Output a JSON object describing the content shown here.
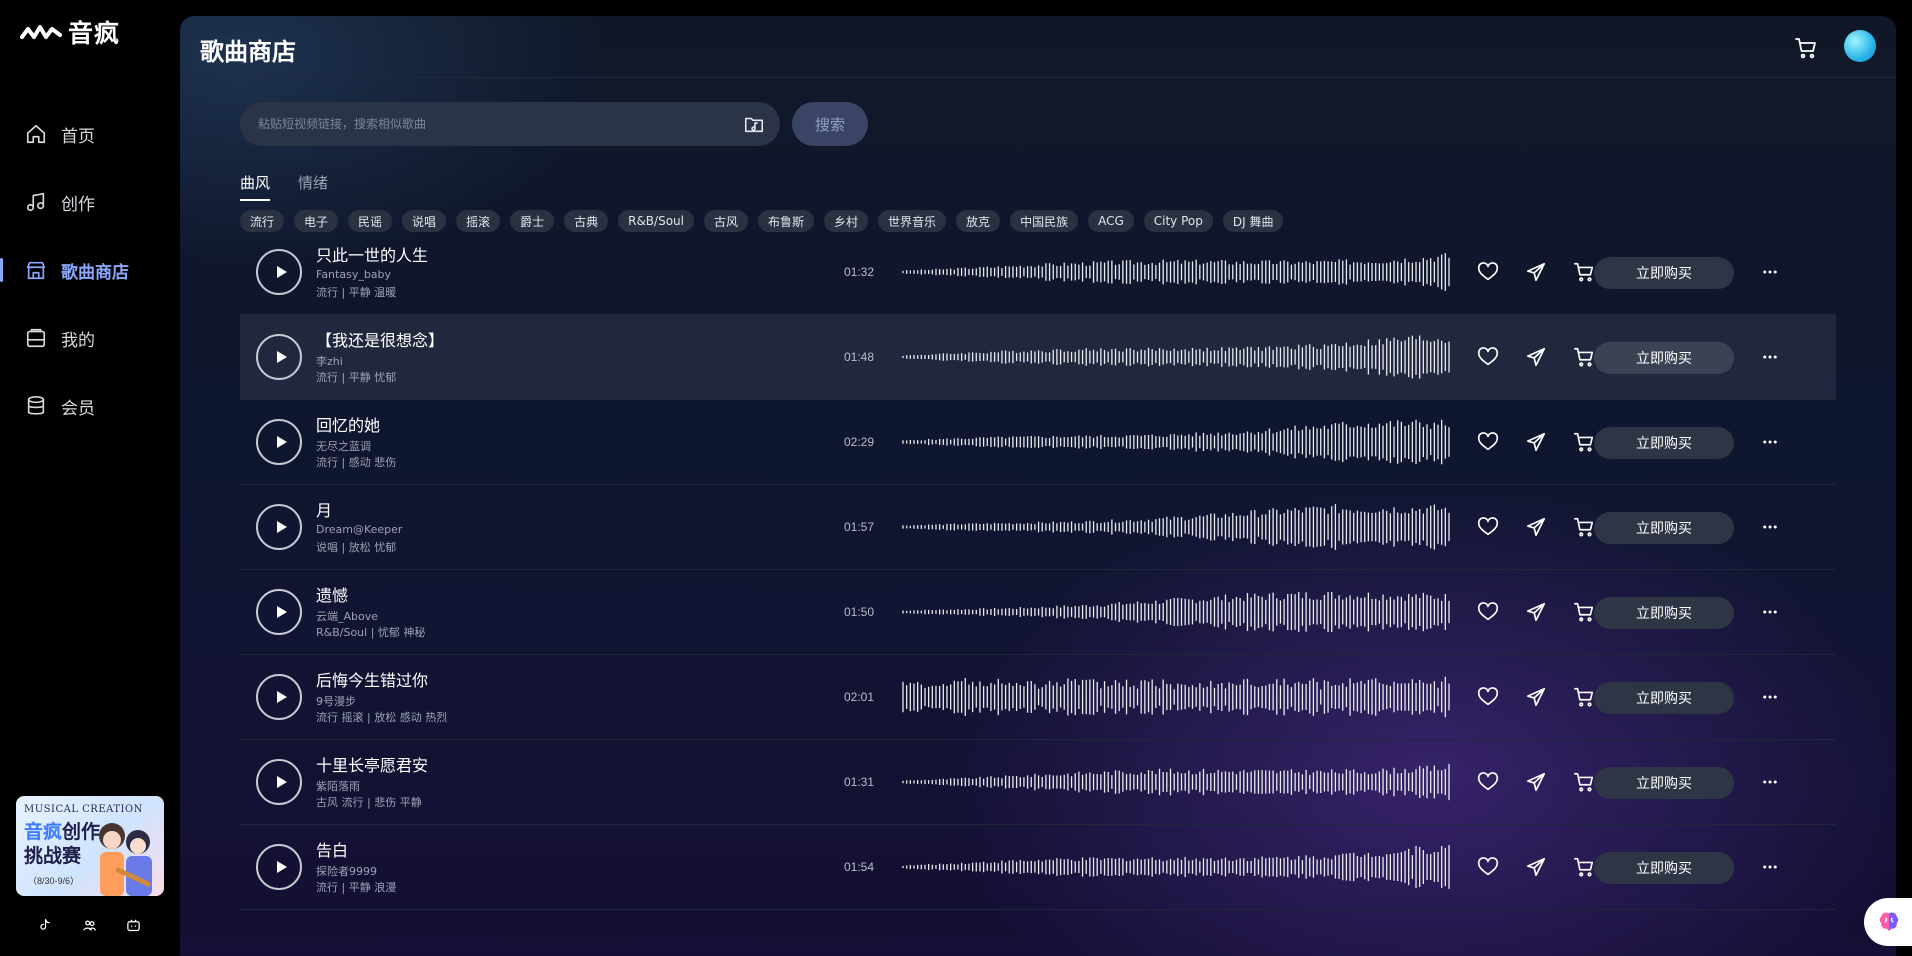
{
  "app": {
    "name": "音疯"
  },
  "sidebar": {
    "items": [
      {
        "label": "首页",
        "icon": "home-icon"
      },
      {
        "label": "创作",
        "icon": "music-note-icon"
      },
      {
        "label": "歌曲商店",
        "icon": "store-icon",
        "active": true
      },
      {
        "label": "我的",
        "icon": "folder-icon"
      },
      {
        "label": "会员",
        "icon": "database-icon"
      }
    ],
    "banner": {
      "top": "MUSICAL CREATION",
      "title_hl": "音疯",
      "title_rest": "创作",
      "title_line2": "挑战赛",
      "date": "（8/30-9/6）"
    }
  },
  "header": {
    "title": "歌曲商店"
  },
  "search": {
    "placeholder": "粘贴短视频链接，搜索相似歌曲",
    "button": "搜索"
  },
  "tabs": [
    {
      "label": "曲风",
      "active": true
    },
    {
      "label": "情绪",
      "active": false
    }
  ],
  "chips": [
    "流行",
    "电子",
    "民谣",
    "说唱",
    "摇滚",
    "爵士",
    "古典",
    "R&B/Soul",
    "古风",
    "布鲁斯",
    "乡村",
    "世界音乐",
    "放克",
    "中国民族",
    "ACG",
    "City Pop",
    "DJ 舞曲"
  ],
  "songs": [
    {
      "title": "只此一世的人生",
      "artist": "Fantasy_baby",
      "tags": "流行 | 平静 温暖",
      "duration": "01:32"
    },
    {
      "title": "【我还是很想念】",
      "artist": "李zhi",
      "tags": "流行 | 平静 忧郁",
      "duration": "01:48"
    },
    {
      "title": "回忆的她",
      "artist": "无尽之蓝调",
      "tags": "流行 | 感动 悲伤",
      "duration": "02:29"
    },
    {
      "title": "月",
      "artist": "Dream@Keeper",
      "tags": "说唱 | 放松 忧郁",
      "duration": "01:57"
    },
    {
      "title": "遗憾",
      "artist": "云端_Above",
      "tags": "R&B/Soul | 忧郁 神秘",
      "duration": "01:50"
    },
    {
      "title": "后悔今生错过你",
      "artist": "9号漫步",
      "tags": "流行 摇滚 | 放松 感动 热烈",
      "duration": "02:01"
    },
    {
      "title": "十里长亭愿君安",
      "artist": "紫陌落雨",
      "tags": "古风 流行 | 悲伤 平静",
      "duration": "01:31"
    },
    {
      "title": "告白",
      "artist": "探险者9999",
      "tags": "流行 | 平静 浪漫",
      "duration": "01:54"
    }
  ],
  "row_actions": {
    "buy_label": "立即购买"
  },
  "colors": {
    "accent": "#8aa8ff",
    "panel": "#101828",
    "chip": "#2a3242",
    "button": "#2e3545"
  }
}
